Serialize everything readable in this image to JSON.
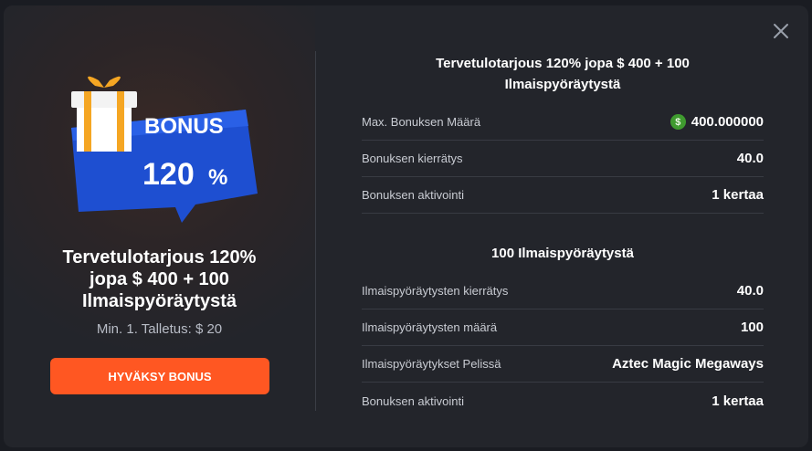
{
  "left": {
    "badge_word": "BONUS",
    "badge_percent": "120",
    "badge_percent_sign": "%",
    "title_lines": [
      "Tervetulotarjous 120%",
      "jopa $ 400 + 100",
      "Ilmaispyöräytystä"
    ],
    "min_deposit": "Min. 1. Talletus: $ 20",
    "accept_button": "HYVÄKSY BONUS"
  },
  "bonus_section": {
    "title_lines": [
      "Tervetulotarjous 120% jopa $ 400 + 100",
      "Ilmaispyöräytystä"
    ],
    "rows": [
      {
        "label": "Max. Bonuksen Määrä",
        "value": "400.000000"
      },
      {
        "label": "Bonuksen kierrätys",
        "value": "40.0"
      },
      {
        "label": "Bonuksen aktivointi",
        "value": "1 kertaa"
      }
    ]
  },
  "freespins_section": {
    "title": "100 Ilmaispyöräytystä",
    "rows": [
      {
        "label": "Ilmaispyöräytysten kierrätys",
        "value": "40.0"
      },
      {
        "label": "Ilmaispyöräytysten määrä",
        "value": "100"
      },
      {
        "label": "Ilmaispyöräytykset Pelissä",
        "value": "Aztec Magic Megaways"
      },
      {
        "label": "Bonuksen aktivointi",
        "value": "1 kertaa"
      }
    ]
  },
  "icons": {
    "close": "close-icon",
    "gift": "gift-icon",
    "currency": "dollar-coin-icon"
  },
  "colors": {
    "modal_bg": "#23252b",
    "accent": "#ff5722",
    "badge_blue": "#1e4fd1",
    "coin_green": "#3f9b2f"
  }
}
